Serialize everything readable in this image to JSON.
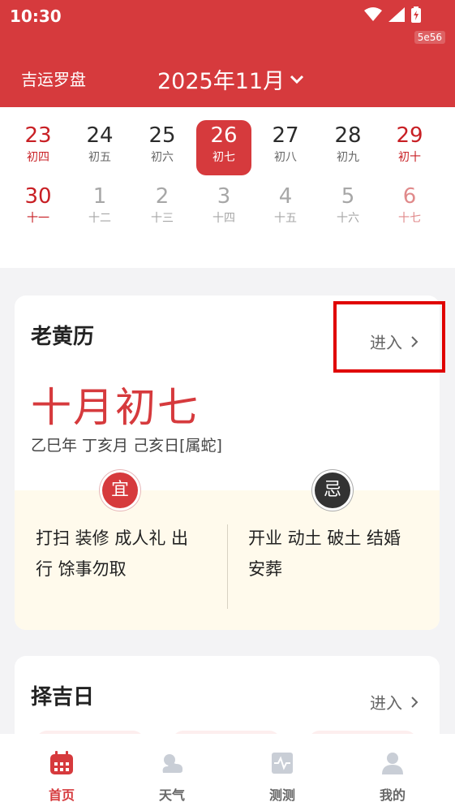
{
  "status": {
    "time": "10:30",
    "tag": "5e56"
  },
  "header": {
    "app_name": "吉运罗盘",
    "month": "2025年11月"
  },
  "calendar": {
    "row1": [
      {
        "num": "23",
        "lunar": "初四"
      },
      {
        "num": "24",
        "lunar": "初五"
      },
      {
        "num": "25",
        "lunar": "初六"
      },
      {
        "num": "26",
        "lunar": "初七"
      },
      {
        "num": "27",
        "lunar": "初八"
      },
      {
        "num": "28",
        "lunar": "初九"
      },
      {
        "num": "29",
        "lunar": "初十"
      }
    ],
    "row2": [
      {
        "num": "30",
        "lunar": "十一"
      },
      {
        "num": "1",
        "lunar": "十二"
      },
      {
        "num": "2",
        "lunar": "十三"
      },
      {
        "num": "3",
        "lunar": "十四"
      },
      {
        "num": "4",
        "lunar": "十五"
      },
      {
        "num": "5",
        "lunar": "十六"
      },
      {
        "num": "6",
        "lunar": "十七"
      }
    ]
  },
  "almanac": {
    "title": "老黄历",
    "enter": "进入",
    "lunar_date": "十月初七",
    "ganzhi": "乙巳年 丁亥月 己亥日[属蛇]",
    "yi_badge": "宜",
    "ji_badge": "忌",
    "yi_text": "打扫 装修 成人礼 出行 馀事勿取",
    "ji_text": "开业 动土 破土 结婚 安葬"
  },
  "lucky_day": {
    "title": "择吉日",
    "enter": "进入"
  },
  "tabbar": {
    "home": "首页",
    "weather": "天气",
    "test": "测测",
    "mine": "我的"
  },
  "colors": {
    "brand": "#d63a3d",
    "highlight": "#e00000"
  }
}
